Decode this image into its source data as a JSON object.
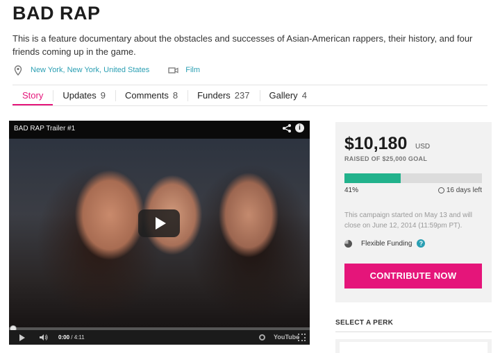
{
  "campaign": {
    "title": "BAD RAP",
    "description": "This is a feature documentary about the obstacles and successes of Asian-American rappers, their history, and four friends coming up in the game.",
    "location": "New York, New York, United States",
    "category": "Film",
    "location_icon": "map-pin-icon",
    "category_icon": "video-camera-icon"
  },
  "tabs": [
    {
      "label": "Story",
      "count": ""
    },
    {
      "label": "Updates",
      "count": "9"
    },
    {
      "label": "Comments",
      "count": "8"
    },
    {
      "label": "Funders",
      "count": "237"
    },
    {
      "label": "Gallery",
      "count": "4"
    }
  ],
  "video": {
    "title": "BAD RAP Trailer #1",
    "time_current": "0:00",
    "time_total": "/ 4:11",
    "youtube_label": "YouTube",
    "progress_fraction": 0.0
  },
  "funding": {
    "amount": "$10,180",
    "currency": "USD",
    "goal_text": "RAISED OF $25,000 GOAL",
    "percent_label": "41%",
    "percent": 41,
    "days_left": "16 days left",
    "note": "This campaign started on May 13 and will close on June 12, 2014 (11:59pm PT).",
    "funding_type": "Flexible Funding",
    "help_glyph": "?",
    "contribute_label": "CONTRIBUTE NOW"
  },
  "perks": {
    "title": "SELECT A PERK"
  },
  "colors": {
    "accent": "#e5157a",
    "link": "#2a9fb3",
    "progress": "#22b28c"
  }
}
